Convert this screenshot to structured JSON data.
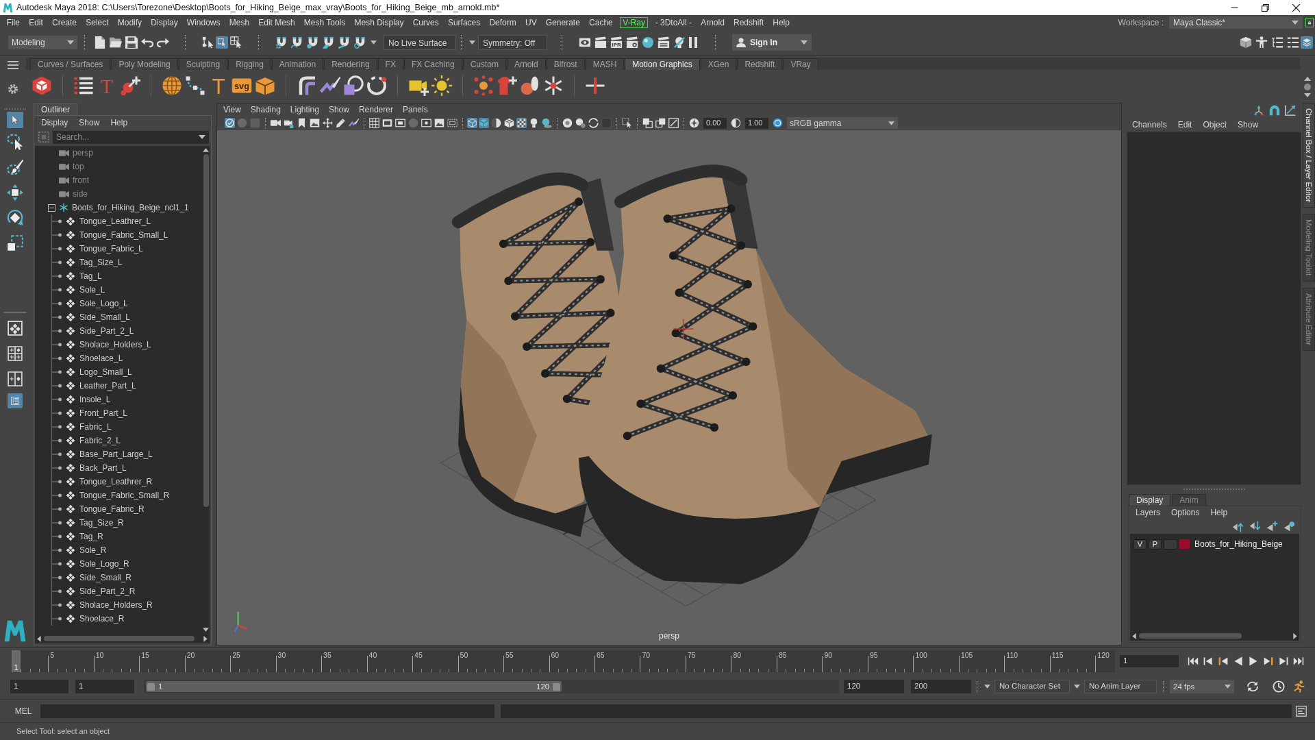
{
  "window": {
    "title": "Autodesk Maya 2018: C:\\Users\\Torezone\\Desktop\\Boots_for_Hiking_Beige_max_vray\\Boots_for_Hiking_Beige_mb_arnold.mb*"
  },
  "menu_bar": {
    "items": [
      {
        "label": "File",
        "kind": "plain"
      },
      {
        "label": "Edit",
        "kind": "plain"
      },
      {
        "label": "Create",
        "kind": "plain"
      },
      {
        "label": "Select",
        "kind": "plain"
      },
      {
        "label": "Modify",
        "kind": "plain"
      },
      {
        "label": "Display",
        "kind": "plain"
      },
      {
        "label": "Windows",
        "kind": "plain"
      },
      {
        "label": "Mesh",
        "kind": "plain"
      },
      {
        "label": "Edit Mesh",
        "kind": "plain"
      },
      {
        "label": "Mesh Tools",
        "kind": "plain"
      },
      {
        "label": "Mesh Display",
        "kind": "plain"
      },
      {
        "label": "Curves",
        "kind": "plain"
      },
      {
        "label": "Surfaces",
        "kind": "plain"
      },
      {
        "label": "Deform",
        "kind": "plain"
      },
      {
        "label": "UV",
        "kind": "plain"
      },
      {
        "label": "Generate",
        "kind": "plain"
      },
      {
        "label": "Cache",
        "kind": "plain"
      },
      {
        "label": "V-Ray",
        "kind": "boxed"
      },
      {
        "label": "- 3DtoAll -",
        "kind": "plain"
      },
      {
        "label": "Arnold",
        "kind": "plain"
      },
      {
        "label": "Redshift",
        "kind": "plain"
      },
      {
        "label": "Help",
        "kind": "plain"
      }
    ],
    "workspace_label": "Workspace :",
    "workspace": "Maya Classic*"
  },
  "status_line": {
    "mode": "Modeling",
    "select_modes": [
      {
        "selected": false
      },
      {
        "selected": true
      },
      {
        "selected": false
      }
    ],
    "live_surface": "No Live Surface",
    "symmetry": "Symmetry: Off",
    "ipr_label": "IPR",
    "sign_in": "Sign In",
    "panel_toggles": [
      {
        "on": false
      },
      {
        "on": false
      },
      {
        "on": false
      },
      {
        "on": false
      },
      {
        "on": true
      }
    ]
  },
  "shelf": {
    "tabs": [
      {
        "label": "Curves / Surfaces",
        "selected": false
      },
      {
        "label": "Poly Modeling",
        "selected": false
      },
      {
        "label": "Sculpting",
        "selected": false
      },
      {
        "label": "Rigging",
        "selected": false
      },
      {
        "label": "Animation",
        "selected": false
      },
      {
        "label": "Rendering",
        "selected": false
      },
      {
        "label": "FX",
        "selected": false
      },
      {
        "label": "FX Caching",
        "selected": false
      },
      {
        "label": "Custom",
        "selected": false
      },
      {
        "label": "Arnold",
        "selected": false
      },
      {
        "label": "Bifrost",
        "selected": false
      },
      {
        "label": "MASH",
        "selected": false
      },
      {
        "label": "Motion Graphics",
        "selected": true
      },
      {
        "label": "XGen",
        "selected": false
      },
      {
        "label": "Redshift",
        "selected": false
      },
      {
        "label": "VRay",
        "selected": false
      }
    ],
    "icon_labels": [
      "T",
      "T",
      "svg"
    ]
  },
  "toolbox": {
    "tools": [
      {
        "selected": true
      },
      {
        "selected": false
      },
      {
        "selected": false
      },
      {
        "selected": false
      },
      {
        "selected": false
      },
      {
        "selected": false
      }
    ],
    "layouts": [
      {
        "selected": false
      },
      {
        "selected": false
      },
      {
        "selected": false
      },
      {
        "selected": true
      }
    ]
  },
  "outliner": {
    "title": "Outliner",
    "menus": [
      "Display",
      "Show",
      "Help"
    ],
    "search": {
      "placeholder": "Search..."
    },
    "items": [
      {
        "label": "persp",
        "kind": "camera"
      },
      {
        "label": "top",
        "kind": "camera"
      },
      {
        "label": "front",
        "kind": "camera"
      },
      {
        "label": "side",
        "kind": "camera"
      },
      {
        "label": "Boots_for_Hiking_Beige_ncl1_1",
        "kind": "group",
        "expanded": true,
        "children": [
          {
            "label": "Tongue_Leathrer_L",
            "kind": "mesh"
          },
          {
            "label": "Tongue_Fabric_Small_L",
            "kind": "mesh"
          },
          {
            "label": "Tongue_Fabric_L",
            "kind": "mesh"
          },
          {
            "label": "Tag_Size_L",
            "kind": "mesh"
          },
          {
            "label": "Tag_L",
            "kind": "mesh"
          },
          {
            "label": "Sole_L",
            "kind": "mesh"
          },
          {
            "label": "Sole_Logo_L",
            "kind": "mesh"
          },
          {
            "label": "Side_Small_L",
            "kind": "mesh"
          },
          {
            "label": "Side_Part_2_L",
            "kind": "mesh"
          },
          {
            "label": "Sholace_Holders_L",
            "kind": "mesh"
          },
          {
            "label": "Shoelace_L",
            "kind": "mesh"
          },
          {
            "label": "Logo_Small_L",
            "kind": "mesh"
          },
          {
            "label": "Leather_Part_L",
            "kind": "mesh"
          },
          {
            "label": "Insole_L",
            "kind": "mesh"
          },
          {
            "label": "Front_Part_L",
            "kind": "mesh"
          },
          {
            "label": "Fabric_L",
            "kind": "mesh"
          },
          {
            "label": "Fabric_2_L",
            "kind": "mesh"
          },
          {
            "label": "Base_Part_Large_L",
            "kind": "mesh"
          },
          {
            "label": "Back_Part_L",
            "kind": "mesh"
          },
          {
            "label": "Tongue_Leathrer_R",
            "kind": "mesh"
          },
          {
            "label": "Tongue_Fabric_Small_R",
            "kind": "mesh"
          },
          {
            "label": "Tongue_Fabric_R",
            "kind": "mesh"
          },
          {
            "label": "Tag_Size_R",
            "kind": "mesh"
          },
          {
            "label": "Tag_R",
            "kind": "mesh"
          },
          {
            "label": "Sole_R",
            "kind": "mesh"
          },
          {
            "label": "Sole_Logo_R",
            "kind": "mesh"
          },
          {
            "label": "Side_Small_R",
            "kind": "mesh"
          },
          {
            "label": "Side_Part_2_R",
            "kind": "mesh"
          },
          {
            "label": "Sholace_Holders_R",
            "kind": "mesh"
          },
          {
            "label": "Shoelace_R",
            "kind": "mesh"
          }
        ]
      }
    ]
  },
  "viewport": {
    "menus": [
      "View",
      "Shading",
      "Lighting",
      "Show",
      "Renderer",
      "Panels"
    ],
    "toolbar_toggles": [
      {
        "on": true
      },
      {
        "on": true
      },
      {
        "on": true
      },
      {
        "on": false
      },
      {
        "on": false
      },
      {
        "on": true
      }
    ],
    "exposure": "0.00",
    "gamma": "1.00",
    "color_space": "sRGB gamma",
    "camera": "persp"
  },
  "channel_box": {
    "menus": [
      "Channels",
      "Edit",
      "Object",
      "Show"
    ]
  },
  "layer_editor": {
    "tabs": [
      {
        "label": "Display",
        "selected": true
      },
      {
        "label": "Anim",
        "selected": false
      }
    ],
    "menus": [
      "Layers",
      "Options",
      "Help"
    ],
    "layers": [
      {
        "visible": "V",
        "playback": "P",
        "color": "#9b0b2b",
        "name": "Boots_for_Hiking_Beige"
      }
    ]
  },
  "side_tabs": [
    {
      "label": "Channel Box / Layer Editor",
      "selected": true
    },
    {
      "label": "Modeling Toolkit",
      "selected": false
    },
    {
      "label": "Attribute Editor",
      "selected": false
    }
  ],
  "time_slider": {
    "current_frame": "1",
    "level": 0,
    "ticks": [
      "5",
      "10",
      "15",
      "20",
      "25",
      "30",
      "35",
      "40",
      "45",
      "50",
      "55",
      "60",
      "65",
      "70",
      "75",
      "80",
      "85",
      "90",
      "95",
      "100",
      "105",
      "110",
      "115",
      "120"
    ],
    "frame_field": "1"
  },
  "range_slider": {
    "start": "1",
    "playback_start": "1",
    "range_start": "1",
    "range_end": "120",
    "level": 0.6,
    "playback_end": "120",
    "end": "200",
    "character_set": "No Character Set",
    "anim_layer": "No Anim Layer",
    "fps": "24 fps"
  },
  "command_line": {
    "language": "MEL"
  },
  "help_line": {
    "text": "Select Tool: select an object"
  }
}
